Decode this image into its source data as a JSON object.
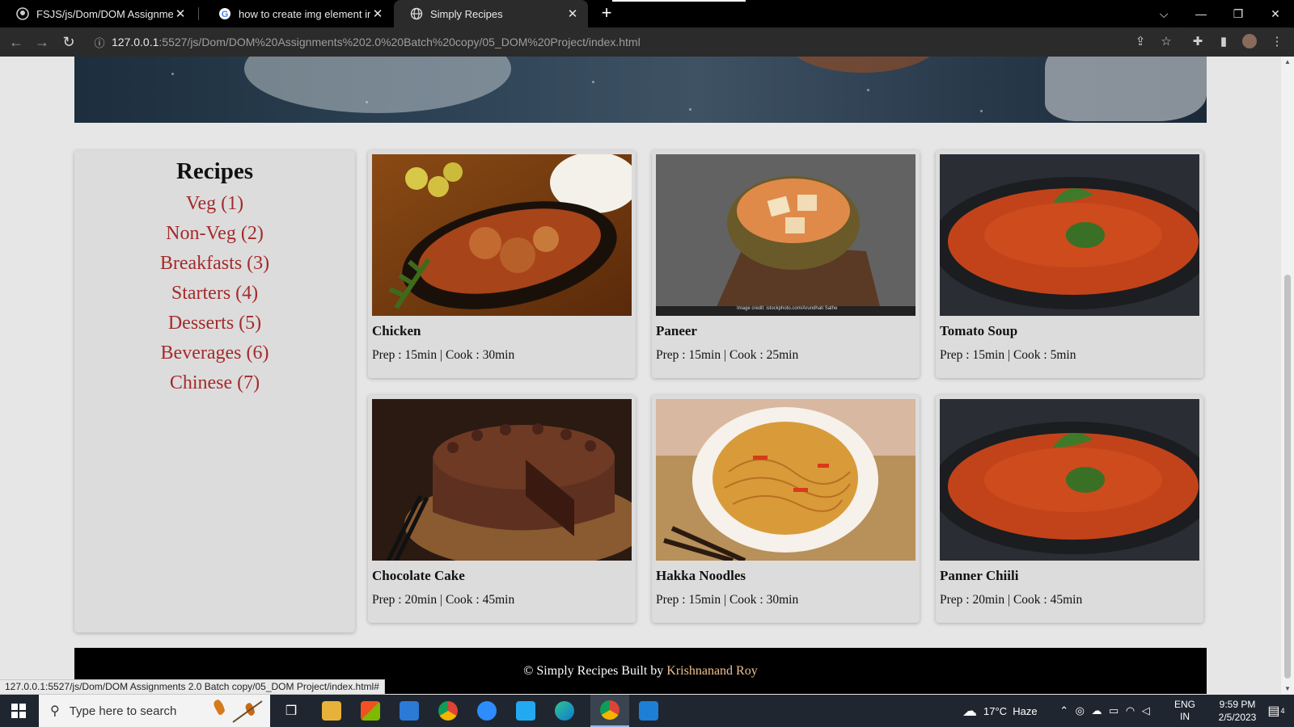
{
  "browser": {
    "tabs": [
      {
        "title": "FSJS/js/Dom/DOM Assignments",
        "close": "✕"
      },
      {
        "title": "how to create img element in java",
        "close": "✕"
      },
      {
        "title": "Simply Recipes",
        "close": "✕"
      }
    ],
    "new_tab": "+",
    "url_host": "127.0.0.1",
    "url_rest": ":5527/js/Dom/DOM%20Assignments%202.0%20Batch%20copy/05_DOM%20Project/index.html",
    "status_url": "127.0.0.1:5527/js/Dom/DOM Assignments 2.0 Batch copy/05_DOM Project/index.html#"
  },
  "sidebar": {
    "heading": "Recipes",
    "categories": [
      {
        "label": "Veg (1)"
      },
      {
        "label": "Non-Veg (2)"
      },
      {
        "label": "Breakfasts (3)"
      },
      {
        "label": "Starters (4)"
      },
      {
        "label": "Desserts (5)"
      },
      {
        "label": "Beverages (6)"
      },
      {
        "label": "Chinese (7)"
      }
    ]
  },
  "recipes": [
    {
      "name": "Chicken",
      "prep": "Prep : 15min",
      "sep": "|",
      "cook": "Cook : 30min"
    },
    {
      "name": "Paneer",
      "prep": "Prep : 15min",
      "sep": "|",
      "cook": "Cook : 25min",
      "credit": "Image credit: istockphoto.com/Arundhati Sathe"
    },
    {
      "name": "Tomato Soup",
      "prep": "Prep : 15min",
      "sep": "|",
      "cook": "Cook : 5min"
    },
    {
      "name": "Chocolate Cake",
      "prep": "Prep : 20min",
      "sep": "|",
      "cook": "Cook : 45min"
    },
    {
      "name": "Hakka Noodles",
      "prep": "Prep : 15min",
      "sep": "|",
      "cook": "Cook : 30min"
    },
    {
      "name": "Panner Chiili",
      "prep": "Prep : 20min",
      "sep": "|",
      "cook": "Cook : 45min"
    }
  ],
  "footer": {
    "text": "© Simply Recipes Built by ",
    "author": "Krishnanand Roy"
  },
  "taskbar": {
    "search_placeholder": "Type here to search",
    "weather_temp": "17°C",
    "weather_desc": "Haze",
    "lang_top": "ENG",
    "lang_bottom": "IN",
    "time": "9:59 PM",
    "date": "2/5/2023",
    "notifications": "4"
  },
  "colors": {
    "link": "#a52a2a",
    "card_bg": "#dcdcdc",
    "page_bg": "#e6e6e6",
    "footer_bg": "#000000"
  }
}
